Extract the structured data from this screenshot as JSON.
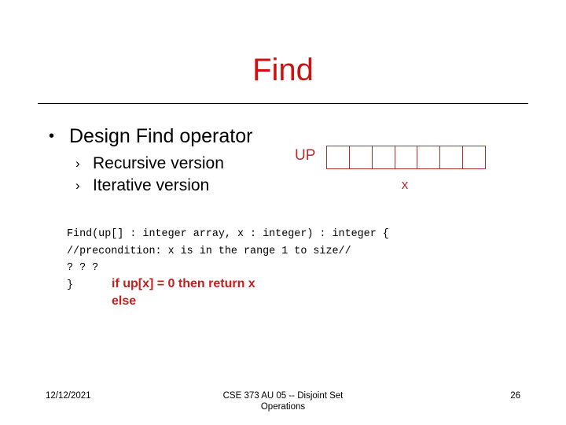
{
  "slide": {
    "title": "Find",
    "background_color": "#ffffff",
    "title_color": "#CC1111",
    "accent_color": "#B03030",
    "redcode_color": "#C41E1E"
  },
  "bullets": {
    "level1": {
      "marker": "•",
      "text": "Design Find operator"
    },
    "level2": [
      {
        "marker": "›",
        "text": "Recursive version"
      },
      {
        "marker": "›",
        "text": "Iterative version"
      }
    ]
  },
  "diagram": {
    "array_label": "UP",
    "index_label": "x",
    "cell_count": 7,
    "cells": [
      "",
      "",
      "",
      "",
      "",
      "",
      ""
    ]
  },
  "code": {
    "lines": [
      "Find(up[] : integer array, x : integer) : integer {",
      "//precondition: x is in the range 1 to size//",
      "? ? ?",
      "}"
    ]
  },
  "redcode": {
    "lines": [
      "if up[x] = 0 then return x",
      "else"
    ]
  },
  "footer": {
    "date": "12/12/2021",
    "center_line1": "CSE 373 AU 05 -- Disjoint Set",
    "center_line2": "Operations",
    "page_number": "26"
  }
}
